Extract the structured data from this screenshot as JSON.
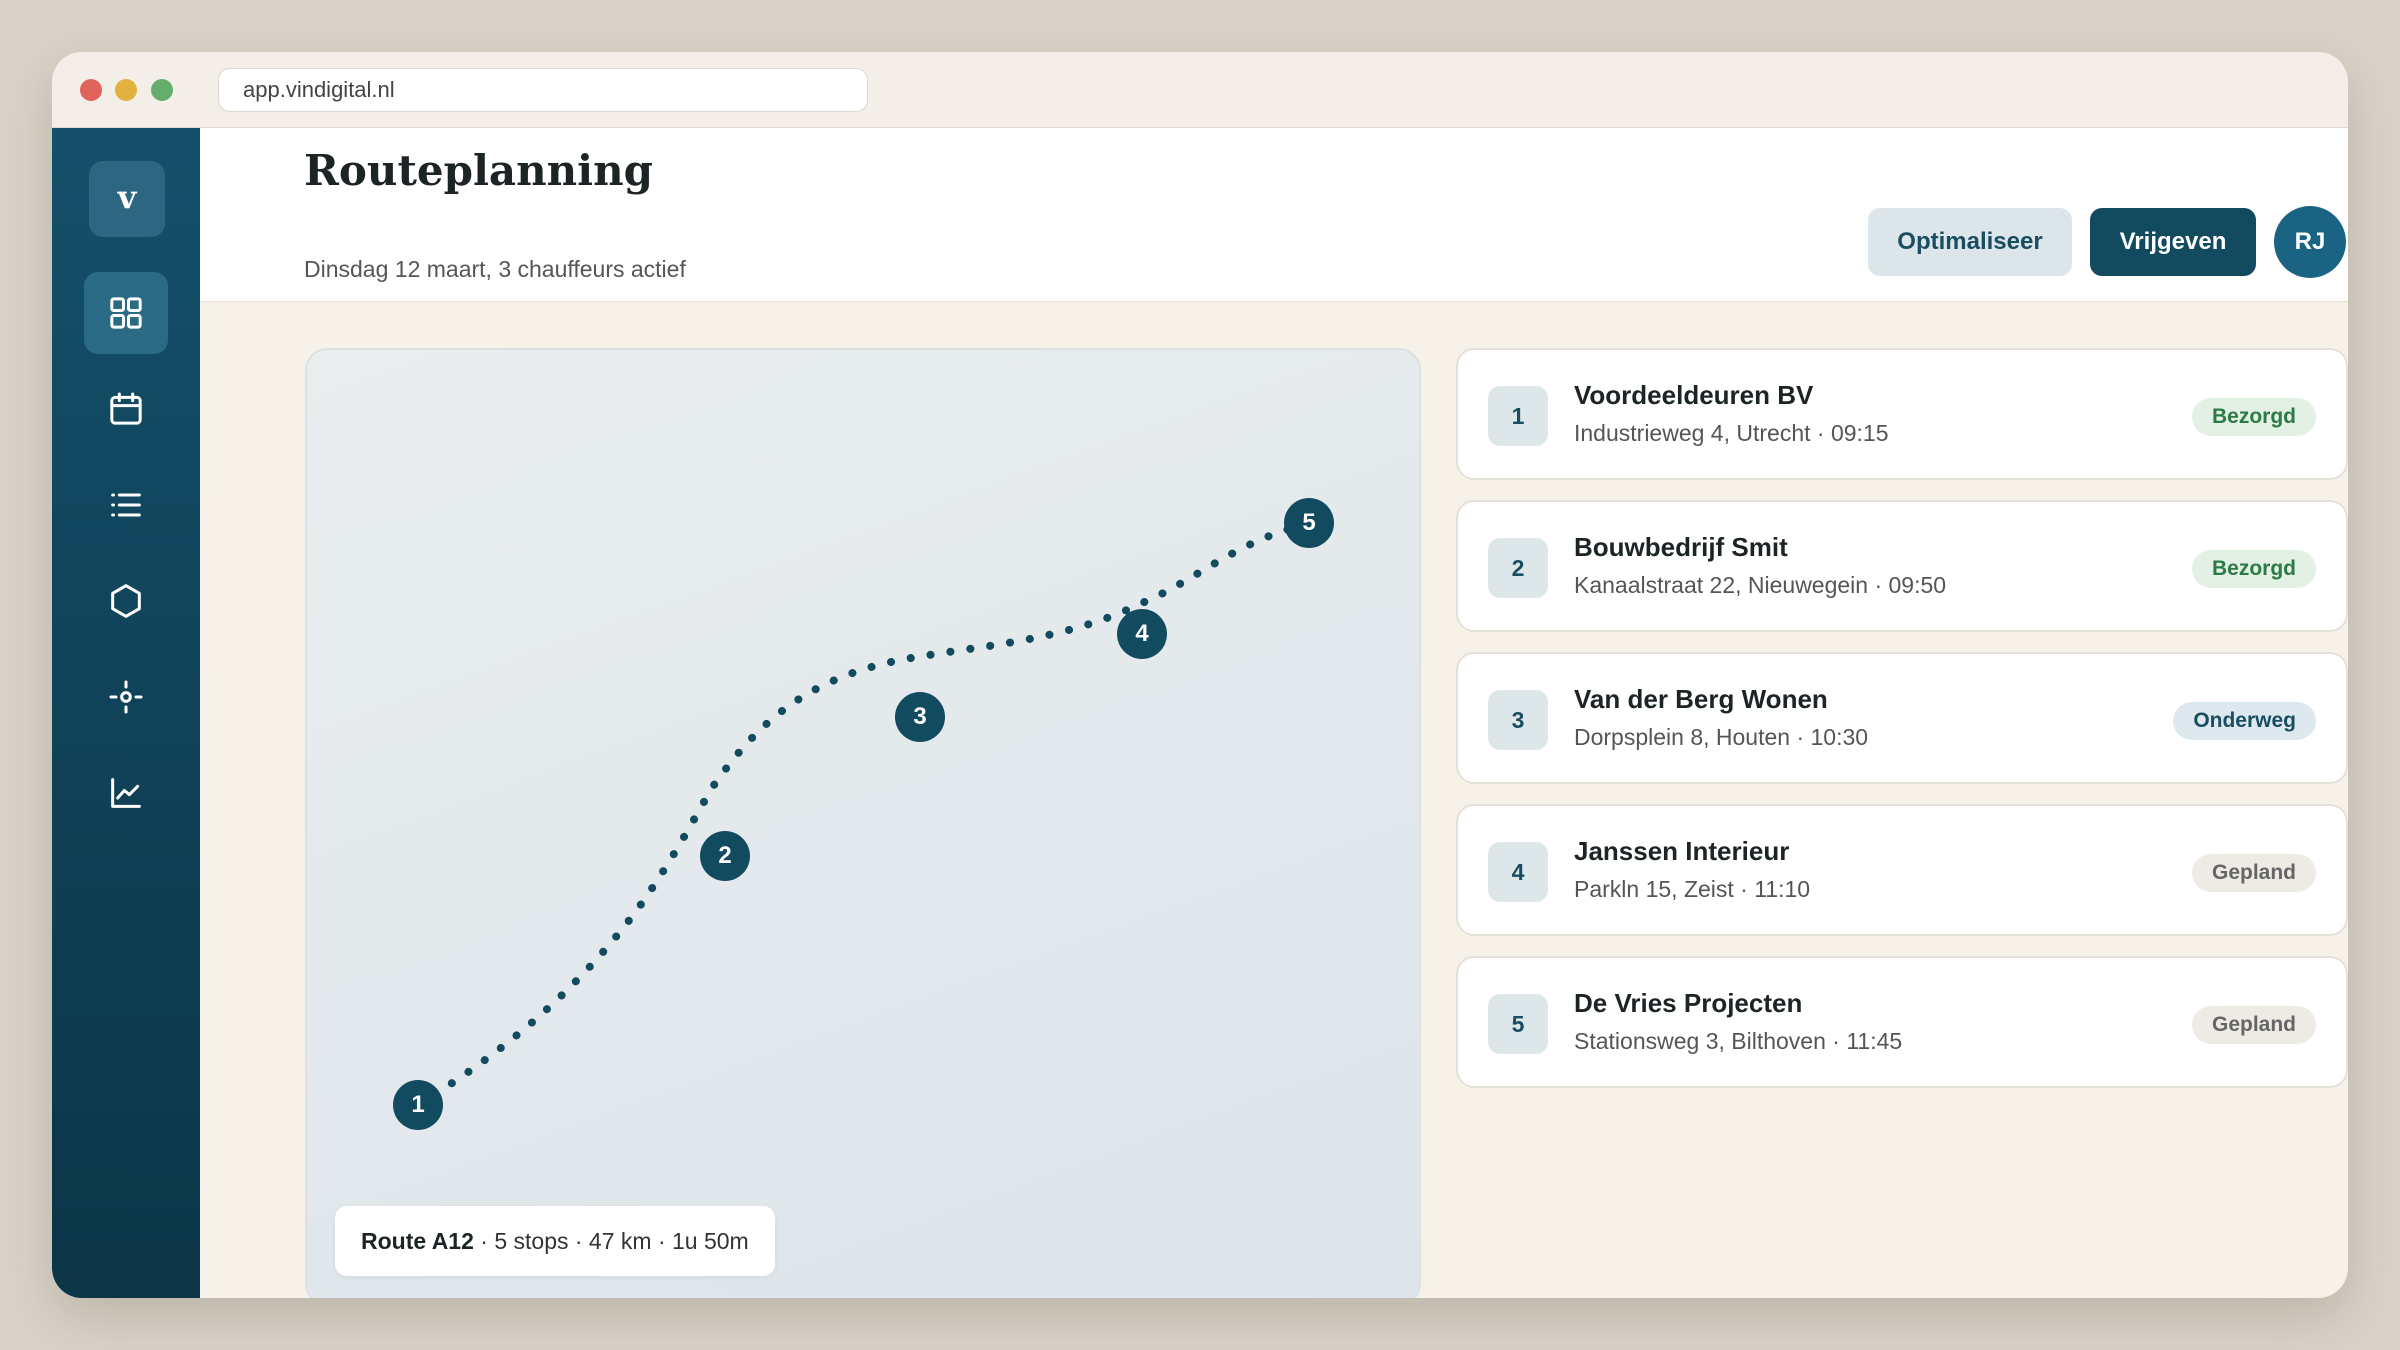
{
  "browser": {
    "url": "app.vindigital.nl"
  },
  "sidebar": {
    "logo": "v",
    "items": [
      {
        "icon": "dashboard-grid-icon",
        "active": true
      },
      {
        "icon": "calendar-icon",
        "active": false
      },
      {
        "icon": "list-icon",
        "active": false
      },
      {
        "icon": "hexagon-icon",
        "active": false
      },
      {
        "icon": "location-target-icon",
        "active": false
      },
      {
        "icon": "line-chart-icon",
        "active": false
      }
    ]
  },
  "header": {
    "title": "Routeplanning",
    "subtitle": "Dinsdag 12 maart, 3 chauffeurs actief",
    "optimize_label": "Optimaliseer",
    "release_label": "Vrijgeven",
    "avatar_initials": "RJ"
  },
  "map": {
    "markers": [
      "1",
      "2",
      "3",
      "4",
      "5"
    ],
    "route_name": "Route A12",
    "route_details": " · 5 stops · 47 km · 1u 50m"
  },
  "stops": [
    {
      "num": "1",
      "name": "Voordeeldeuren BV",
      "meta": "Industrieweg 4, Utrecht · 09:15",
      "status": "Bezorgd",
      "status_type": "done"
    },
    {
      "num": "2",
      "name": "Bouwbedrijf Smit",
      "meta": "Kanaalstraat 22, Nieuwegein · 09:50",
      "status": "Bezorgd",
      "status_type": "done"
    },
    {
      "num": "3",
      "name": "Van der Berg Wonen",
      "meta": "Dorpsplein 8, Houten · 10:30",
      "status": "Onderweg",
      "status_type": "progress"
    },
    {
      "num": "4",
      "name": "Janssen Interieur",
      "meta": "Parkln 15, Zeist · 11:10",
      "status": "Gepland",
      "status_type": "planned"
    },
    {
      "num": "5",
      "name": "De Vries Projecten",
      "meta": "Stationsweg 3, Bilthoven · 11:45",
      "status": "Gepland",
      "status_type": "planned"
    }
  ],
  "colors": {
    "sidebar": "#124a5f",
    "accent": "#124a5f",
    "done": "#2c7a45",
    "background": "#f6f2ea"
  }
}
